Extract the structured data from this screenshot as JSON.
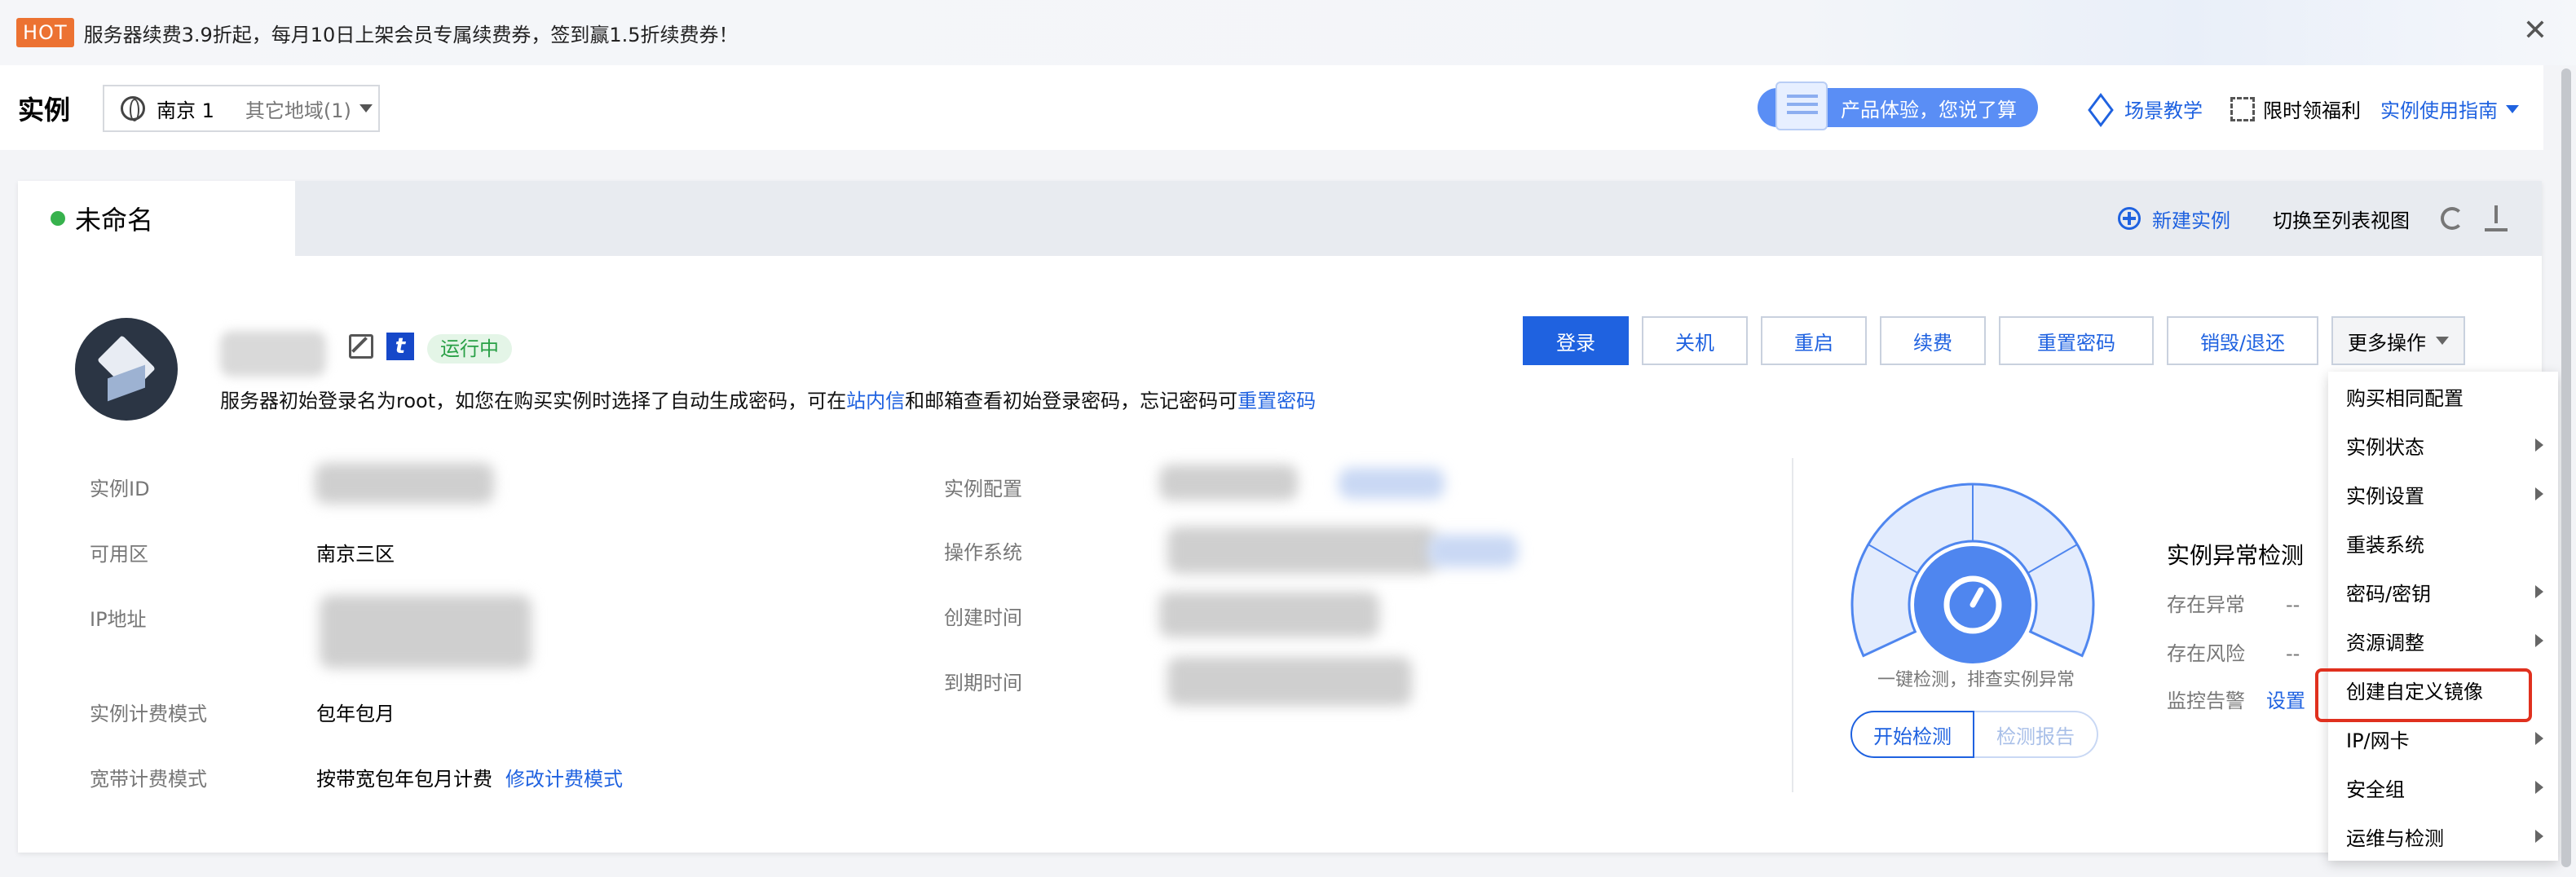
{
  "banner": {
    "hot_label": "HOT",
    "text": "服务器续费3.9折起，每月10日上架会员专属续费券，签到赢1.5折续费券！",
    "close_glyph": "✕"
  },
  "header": {
    "title": "实例",
    "region_current": "南京 1",
    "region_other": "其它地域(1)",
    "feedback_label": "产品体验，您说了算",
    "link_scene": "场景教学",
    "link_welfare": "限时领福利",
    "link_guide": "实例使用指南"
  },
  "tab": {
    "label": "未命名",
    "new_instance": "新建实例",
    "switch_view": "切换至列表视图"
  },
  "server": {
    "status": "运行中",
    "t_icon": "t",
    "notice_pre": "服务器初始登录名为root，如您在购买实例时选择了自动生成密码，可在",
    "notice_link1": "站内信",
    "notice_mid": "和邮箱查看初始登录密码，忘记密码可",
    "notice_link2": "重置密码"
  },
  "actions": {
    "login": "登录",
    "shutdown": "关机",
    "restart": "重启",
    "renew": "续费",
    "reset_password": "重置密码",
    "destroy": "销毁/退还",
    "more": "更多操作"
  },
  "info": {
    "instance_id_label": "实例ID",
    "zone_label": "可用区",
    "zone_value": "南京三区",
    "ip_label": "IP地址",
    "billing_label": "实例计费模式",
    "billing_value": "包年包月",
    "bandwidth_label": "宽带计费模式",
    "bandwidth_value": "按带宽包年包月计费",
    "bandwidth_link": "修改计费模式",
    "config_label": "实例配置",
    "os_label": "操作系统",
    "created_label": "创建时间",
    "expire_label": "到期时间"
  },
  "check": {
    "caption": "一键检测，排查实例异常",
    "start_btn": "开始检测",
    "report_btn": "检测报告",
    "title": "实例异常检测",
    "exception_label": "存在异常",
    "exception_value": "--",
    "risk_label": "存在风险",
    "risk_value": "--",
    "alarm_label": "监控告警",
    "alarm_link": "设置"
  },
  "menu": {
    "items": [
      {
        "label": "购买相同配置",
        "submenu": false
      },
      {
        "label": "实例状态",
        "submenu": true
      },
      {
        "label": "实例设置",
        "submenu": true
      },
      {
        "label": "重装系统",
        "submenu": false
      },
      {
        "label": "密码/密钥",
        "submenu": true
      },
      {
        "label": "资源调整",
        "submenu": true
      },
      {
        "label": "创建自定义镜像",
        "submenu": false
      },
      {
        "label": "IP/网卡",
        "submenu": true
      },
      {
        "label": "安全组",
        "submenu": true
      },
      {
        "label": "运维与检测",
        "submenu": true
      }
    ]
  },
  "colors": {
    "primary": "#1f62e0",
    "hot": "#ec7232",
    "running": "#29a046",
    "highlight": "#e0301e",
    "gauge": "#4f86ef"
  }
}
